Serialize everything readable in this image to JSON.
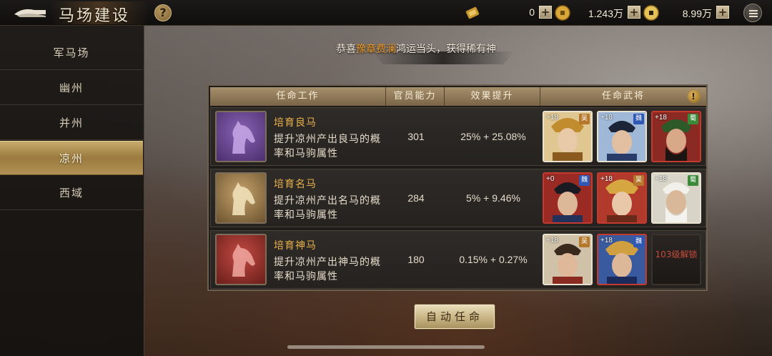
{
  "header": {
    "title": "马场建设",
    "help_label": "?",
    "resources": [
      {
        "icon": "scroll-token-icon",
        "value": "0",
        "plus": "+"
      },
      {
        "icon": "copper-coin-icon",
        "value": "1.243万",
        "plus": "+"
      },
      {
        "icon": "gold-coin-icon",
        "value": "8.99万",
        "plus": "+"
      }
    ]
  },
  "sidebar": {
    "items": [
      {
        "label": "军马场",
        "active": false
      },
      {
        "label": "幽州",
        "active": false
      },
      {
        "label": "并州",
        "active": false
      },
      {
        "label": "凉州",
        "active": true
      },
      {
        "label": "西域",
        "active": false
      }
    ]
  },
  "announcement": {
    "prefix": "恭喜",
    "name": "豫章费澜",
    "suffix": "鸿运当头，获得稀有神"
  },
  "table": {
    "headers": [
      "任命工作",
      "官员能力",
      "效果提升",
      "任命武将"
    ],
    "warn_label": "!",
    "rows": [
      {
        "name": "培育良马",
        "desc": "提升凉州产出良马的概率和马驹属性",
        "ability": "301",
        "effect": "25% + 25.08%",
        "icon_color": "#6b4a94",
        "generals": [
          {
            "bonus": "+18",
            "faction": "吴"
          },
          {
            "bonus": "+18",
            "faction": "魏"
          },
          {
            "bonus": "+18",
            "faction": "蜀"
          }
        ],
        "locked": ""
      },
      {
        "name": "培育名马",
        "desc": "提升凉州产出名马的概率和马驹属性",
        "ability": "284",
        "effect": "5% + 9.46%",
        "icon_color": "#a0804a",
        "generals": [
          {
            "bonus": "+0",
            "faction": "魏"
          },
          {
            "bonus": "+18",
            "faction": "吴"
          },
          {
            "bonus": "+18",
            "faction": "蜀"
          }
        ],
        "locked": ""
      },
      {
        "name": "培育神马",
        "desc": "提升凉州产出神马的概率和马驹属性",
        "ability": "180",
        "effect": "0.15% + 0.27%",
        "icon_color": "#a3302a",
        "generals": [
          {
            "bonus": "+18",
            "faction": "吴"
          },
          {
            "bonus": "+18",
            "faction": "魏"
          }
        ],
        "locked": "103级解锁"
      }
    ]
  },
  "auto_button": "自动任命"
}
